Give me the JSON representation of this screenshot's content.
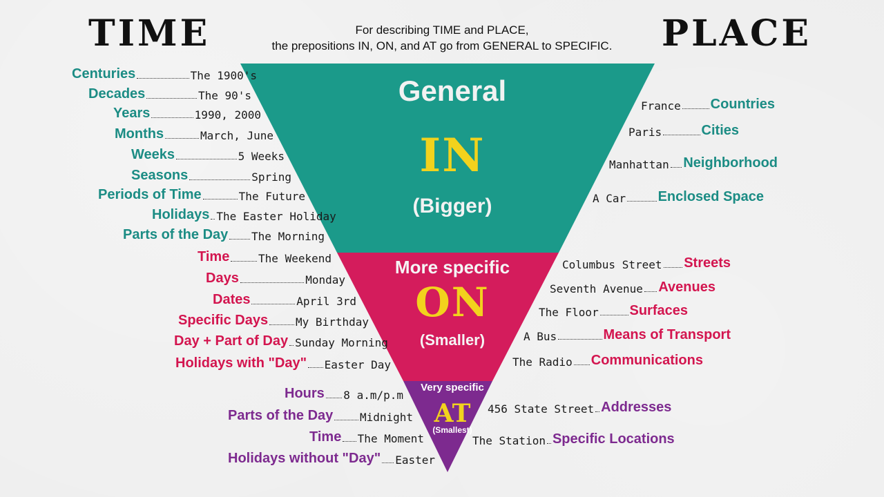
{
  "header": {
    "time_title": "TIME",
    "place_title": "PLACE",
    "subtitle_line1": "For describing TIME and PLACE,",
    "subtitle_line2": "the prepositions IN, ON, and AT go from GENERAL to SPECIFIC."
  },
  "colors": {
    "in": "#1b9a8a",
    "on": "#d41c5c",
    "at": "#7d2a8f",
    "preposition_yellow": "#f2d21d"
  },
  "triangle": {
    "in": {
      "label": "General",
      "preposition": "IN",
      "size": "(Bigger)"
    },
    "on": {
      "label": "More specific",
      "preposition": "ON",
      "size": "(Smaller)"
    },
    "at": {
      "label": "Very specific",
      "preposition": "AT",
      "size": "(Smallest)"
    }
  },
  "time": {
    "in": [
      {
        "category": "Centuries",
        "example": "The 1900's"
      },
      {
        "category": "Decades",
        "example": "The 90's"
      },
      {
        "category": "Years",
        "example": "1990, 2000"
      },
      {
        "category": "Months",
        "example": "March, June"
      },
      {
        "category": "Weeks",
        "example": "5 Weeks"
      },
      {
        "category": "Seasons",
        "example": "Spring"
      },
      {
        "category": "Periods of Time",
        "example": "The Future"
      },
      {
        "category": "Holidays",
        "example": "The Easter Holiday"
      },
      {
        "category": "Parts of the Day",
        "example": "The Morning"
      }
    ],
    "on": [
      {
        "category": "Time",
        "example": "The Weekend"
      },
      {
        "category": "Days",
        "example": "Monday"
      },
      {
        "category": "Dates",
        "example": "April 3rd"
      },
      {
        "category": "Specific Days",
        "example": "My Birthday"
      },
      {
        "category": "Day + Part of Day",
        "example": "Sunday Morning"
      },
      {
        "category": "Holidays with \"Day\"",
        "example": "Easter Day"
      }
    ],
    "at": [
      {
        "category": "Hours",
        "example": "8 a.m/p.m"
      },
      {
        "category": "Parts of the Day",
        "example": "Midnight"
      },
      {
        "category": "Time",
        "example": "The Moment"
      },
      {
        "category": "Holidays without \"Day\"",
        "example": "Easter"
      }
    ]
  },
  "place": {
    "in": [
      {
        "example": "France",
        "category": "Countries"
      },
      {
        "example": "Paris",
        "category": "Cities"
      },
      {
        "example": "Manhattan",
        "category": "Neighborhood"
      },
      {
        "example": "A Car",
        "category": "Enclosed Space"
      }
    ],
    "on": [
      {
        "example": "Columbus Street",
        "category": "Streets"
      },
      {
        "example": "Seventh Avenue",
        "category": "Avenues"
      },
      {
        "example": "The Floor",
        "category": "Surfaces"
      },
      {
        "example": "A Bus",
        "category": "Means of Transport"
      },
      {
        "example": "The Radio",
        "category": "Communications"
      }
    ],
    "at": [
      {
        "example": "456 State Street",
        "category": "Addresses"
      },
      {
        "example": "The Station",
        "category": "Specific Locations"
      }
    ]
  }
}
